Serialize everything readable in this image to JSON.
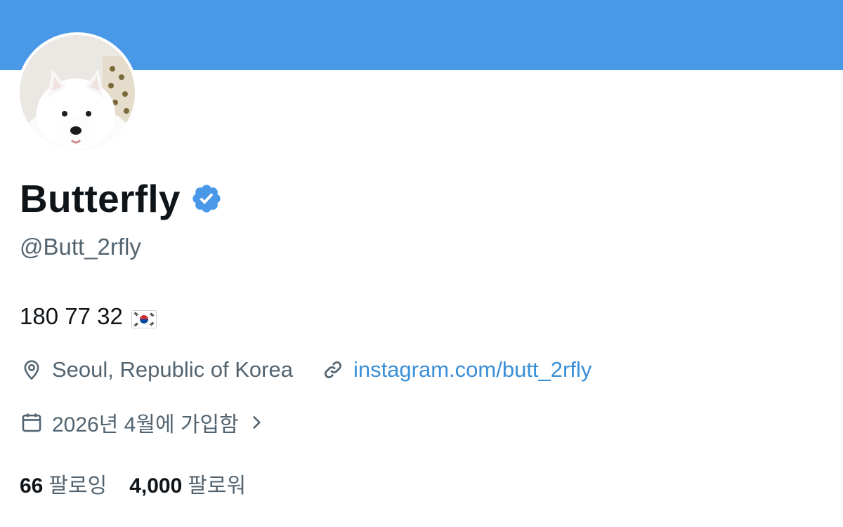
{
  "profile": {
    "display_name": "Butterfly",
    "handle": "@Butt_2rfly",
    "bio": "180 77 32",
    "bio_flag": "south-korea-flag-emoji",
    "location": "Seoul, Republic of Korea",
    "website": "instagram.com/butt_2rfly",
    "joined": "2026년 4월에 가입함",
    "following_count": "66",
    "following_label": "팔로잉",
    "followers_count": "4,000",
    "followers_label": "팔로워",
    "verified": true
  },
  "icons": {
    "verified": "verified-badge-icon",
    "location": "map-pin-icon",
    "website": "link-icon",
    "joined": "calendar-icon",
    "more": "chevron-right-icon"
  },
  "colors": {
    "banner": "#4a99e9",
    "verified": "#4a99e9",
    "link": "#3a8fd8",
    "text_primary": "#0f1419",
    "text_secondary": "#536471"
  }
}
